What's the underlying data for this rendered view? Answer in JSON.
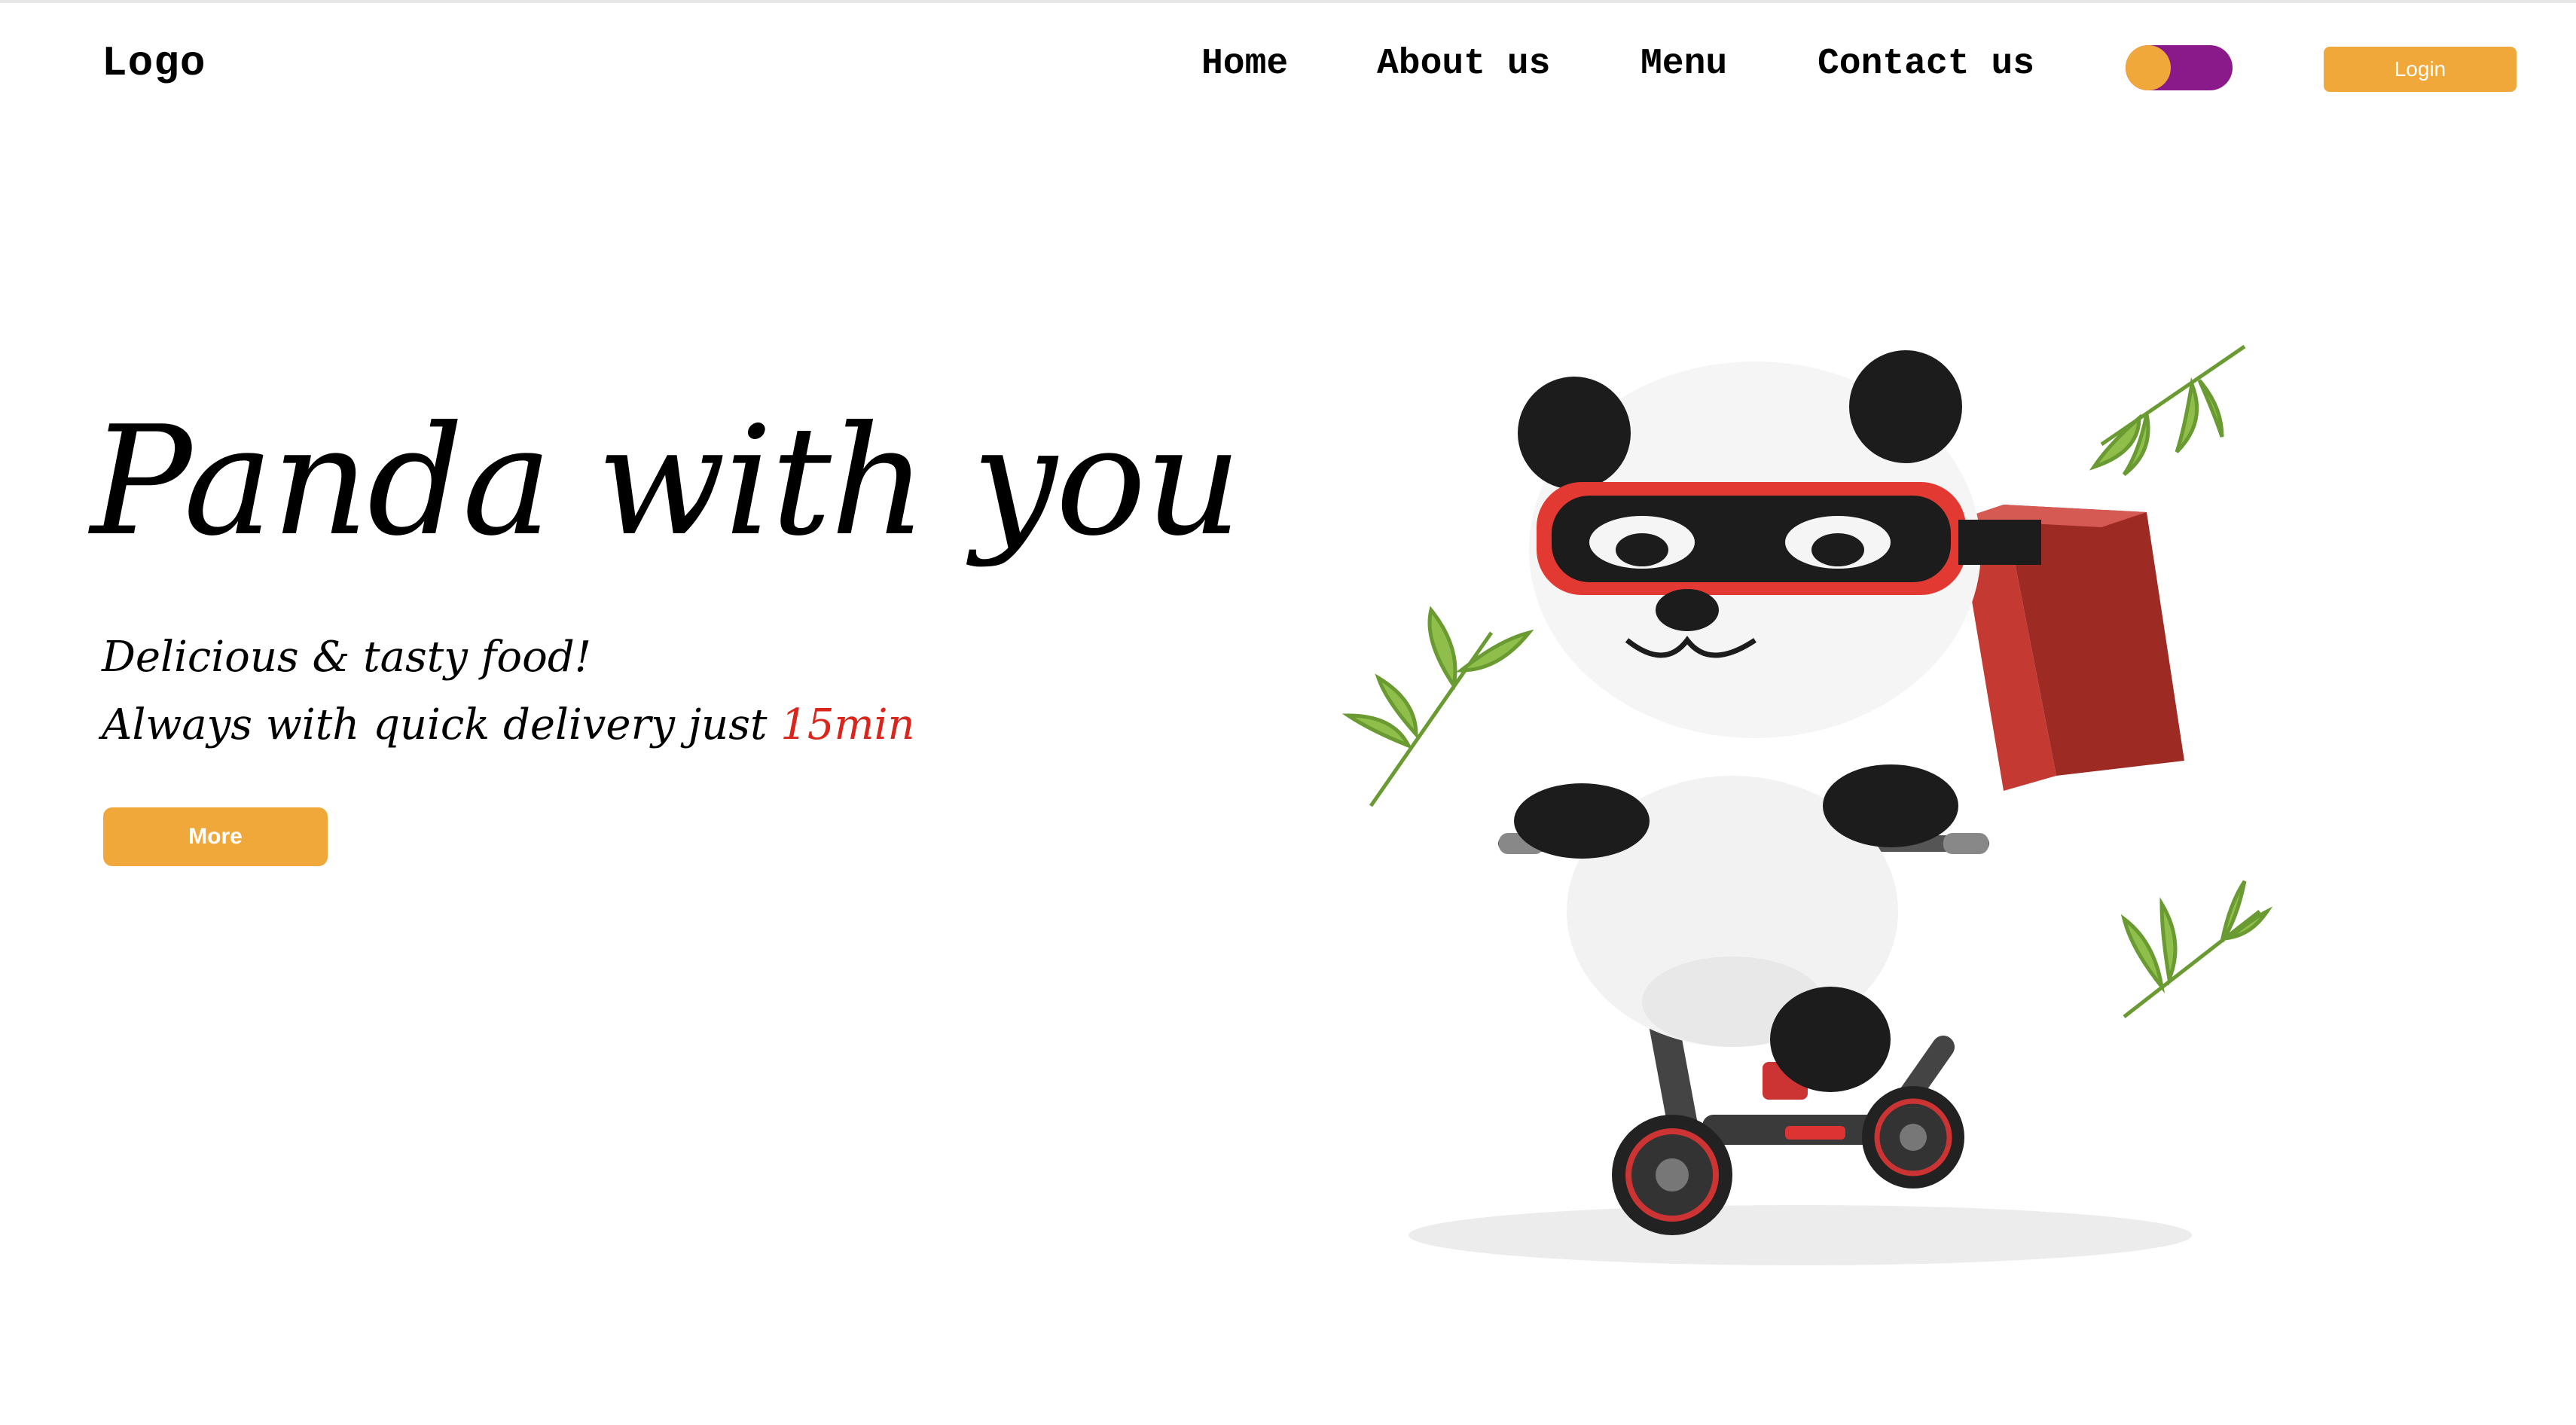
{
  "header": {
    "logo": "Logo",
    "nav": {
      "home": "Home",
      "about": "About us",
      "menu": "Menu",
      "contact": "Contact us"
    },
    "login_label": "Login"
  },
  "hero": {
    "title": "Panda with you",
    "subtitle_line1": "Delicious & tasty food!",
    "subtitle_line2_prefix": "Always with quick delivery just ",
    "subtitle_line2_highlight": "15min",
    "more_label": "More",
    "illustration": "panda-riding-scooter-with-delivery-box"
  },
  "colors": {
    "accent": "#f0a83a",
    "toggle_track": "#8a1a8a",
    "highlight": "#d9261c",
    "delivery_box": "#b8322c",
    "bamboo": "#7cac3e"
  }
}
